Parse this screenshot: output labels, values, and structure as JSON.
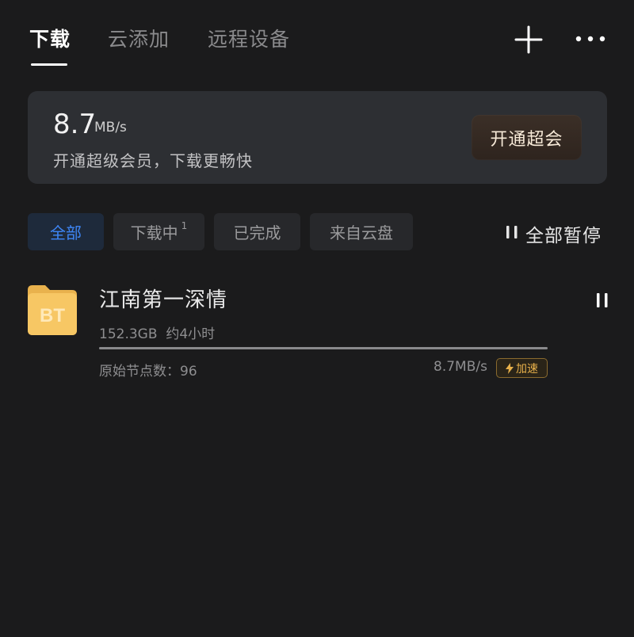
{
  "tabs": [
    {
      "label": "下载",
      "active": true
    },
    {
      "label": "云添加",
      "active": false
    },
    {
      "label": "远程设备",
      "active": false
    }
  ],
  "header_icons": {
    "add": "plus-icon",
    "more": "more-icon"
  },
  "speed_card": {
    "value": "8.7",
    "unit": "MB/s",
    "promo_text": "开通超级会员，下载更畅快",
    "vip_button_label": "开通超会"
  },
  "filters": {
    "all": "全部",
    "downloading": "下载中",
    "downloading_count": "1",
    "completed": "已完成",
    "cloud": "来自云盘",
    "active": "all"
  },
  "pause_all_label": "全部暂停",
  "downloads": [
    {
      "icon_label": "BT",
      "title": "江南第一深情",
      "size": "152.3GB",
      "eta": "约4小时",
      "source_nodes": "原始节点数：96",
      "speed": "8.7MB/s",
      "accelerate_label": "加速",
      "progress": 1.0
    }
  ],
  "colors": {
    "background": "#1b1b1c",
    "card": "#2d2f33",
    "accent_blue": "#3e86f6",
    "accel_gold": "#e7b04a",
    "folder_yellow": "#f7c764"
  }
}
